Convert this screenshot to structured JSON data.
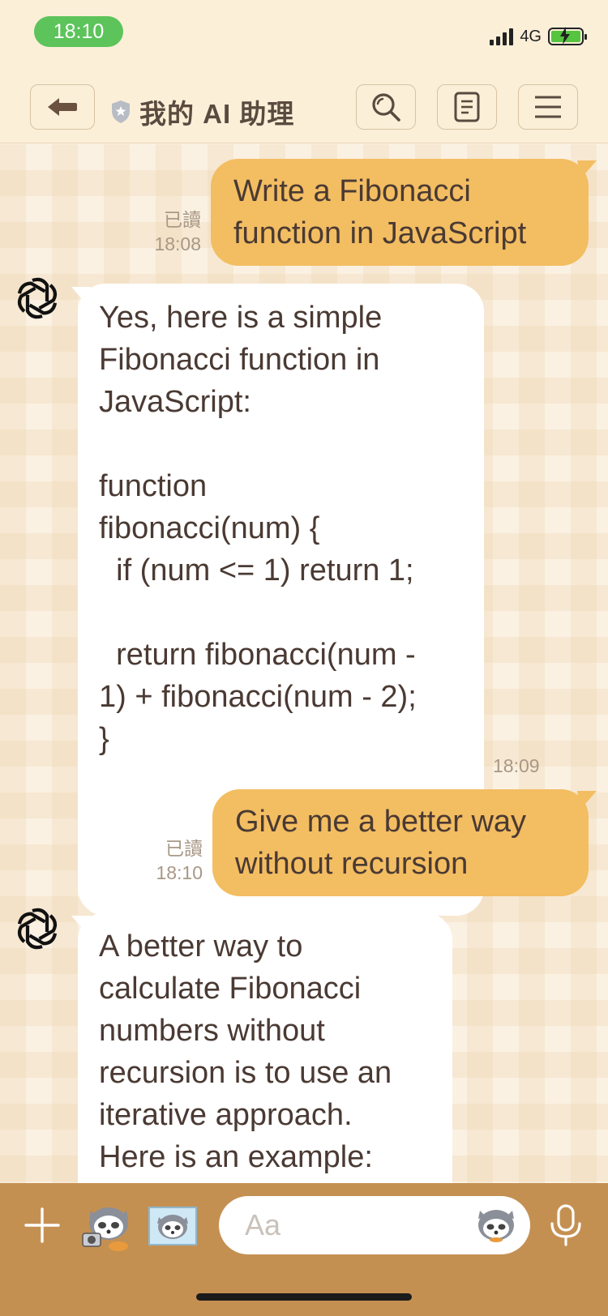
{
  "status_bar": {
    "time": "18:10",
    "network": "4G",
    "battery_charging": true
  },
  "header": {
    "title": "我的 AI 助理",
    "icons": {
      "back": "back-arrow-icon",
      "verified": "shield-star-icon",
      "search": "search-icon",
      "notes": "notes-icon",
      "menu": "hamburger-menu-icon"
    }
  },
  "messages": [
    {
      "sender": "user",
      "text": "Write a Fibonacci\nfunction in JavaScript",
      "read_label": "已讀",
      "time": "18:08"
    },
    {
      "sender": "bot",
      "text": "Yes, here is a simple\nFibonacci function in\nJavaScript:\n\nfunction\nfibonacci(num) {\n  if (num <= 1) return 1;\n\n  return fibonacci(num -\n1) + fibonacci(num - 2);\n}",
      "time": "18:09"
    },
    {
      "sender": "user",
      "text": "Give me a better way\nwithout recursion",
      "read_label": "已讀",
      "time": "18:10"
    },
    {
      "sender": "bot",
      "text": "A better way to\ncalculate Fibonacci\nnumbers without\nrecursion is to use an\niterative approach.\nHere is an example:",
      "time": ""
    }
  ],
  "input_bar": {
    "placeholder": "Aa",
    "icons": {
      "add": "plus-icon",
      "camera_sticker": "raccoon-camera-sticker-icon",
      "photo_sticker": "raccoon-photo-sticker-icon",
      "emoji_sticker": "raccoon-sticker-icon",
      "mic": "microphone-icon"
    }
  },
  "colors": {
    "user_bubble": "#f3bd62",
    "bot_bubble": "#ffffff",
    "header_bg": "#fbefd8",
    "input_bar_bg": "#c49052",
    "status_time_pill": "#5cc45a"
  }
}
